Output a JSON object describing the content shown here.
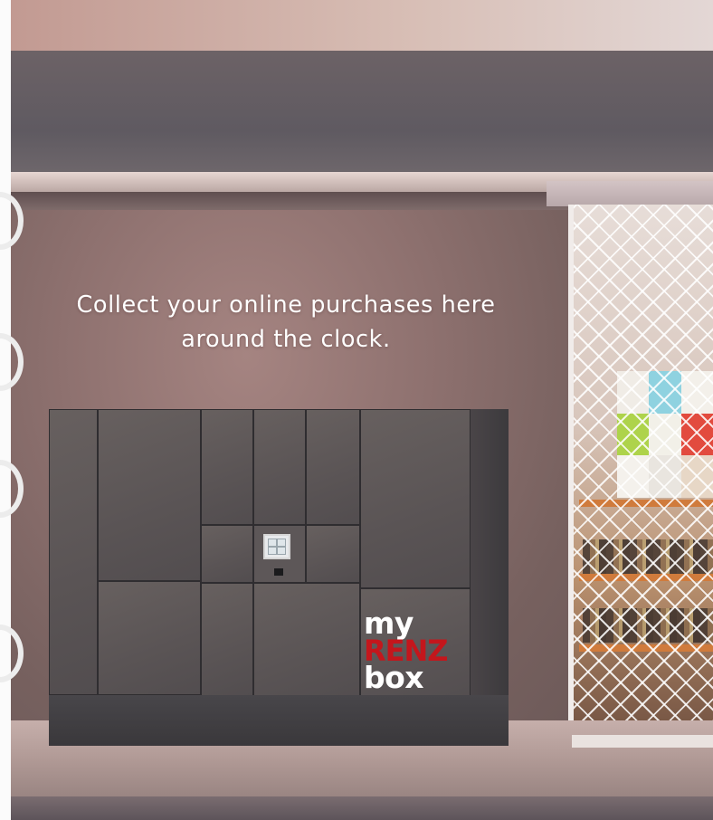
{
  "scene": {
    "headline_line1": "Collect your online purchases here",
    "headline_line2": "around the clock.",
    "brand": {
      "line1": "my",
      "line2": "RENZ",
      "line3": "box",
      "colors": {
        "primary_text": "#ffffff",
        "accent": "#c4161c"
      }
    },
    "icons": [
      "locker-terminal-icon"
    ]
  }
}
